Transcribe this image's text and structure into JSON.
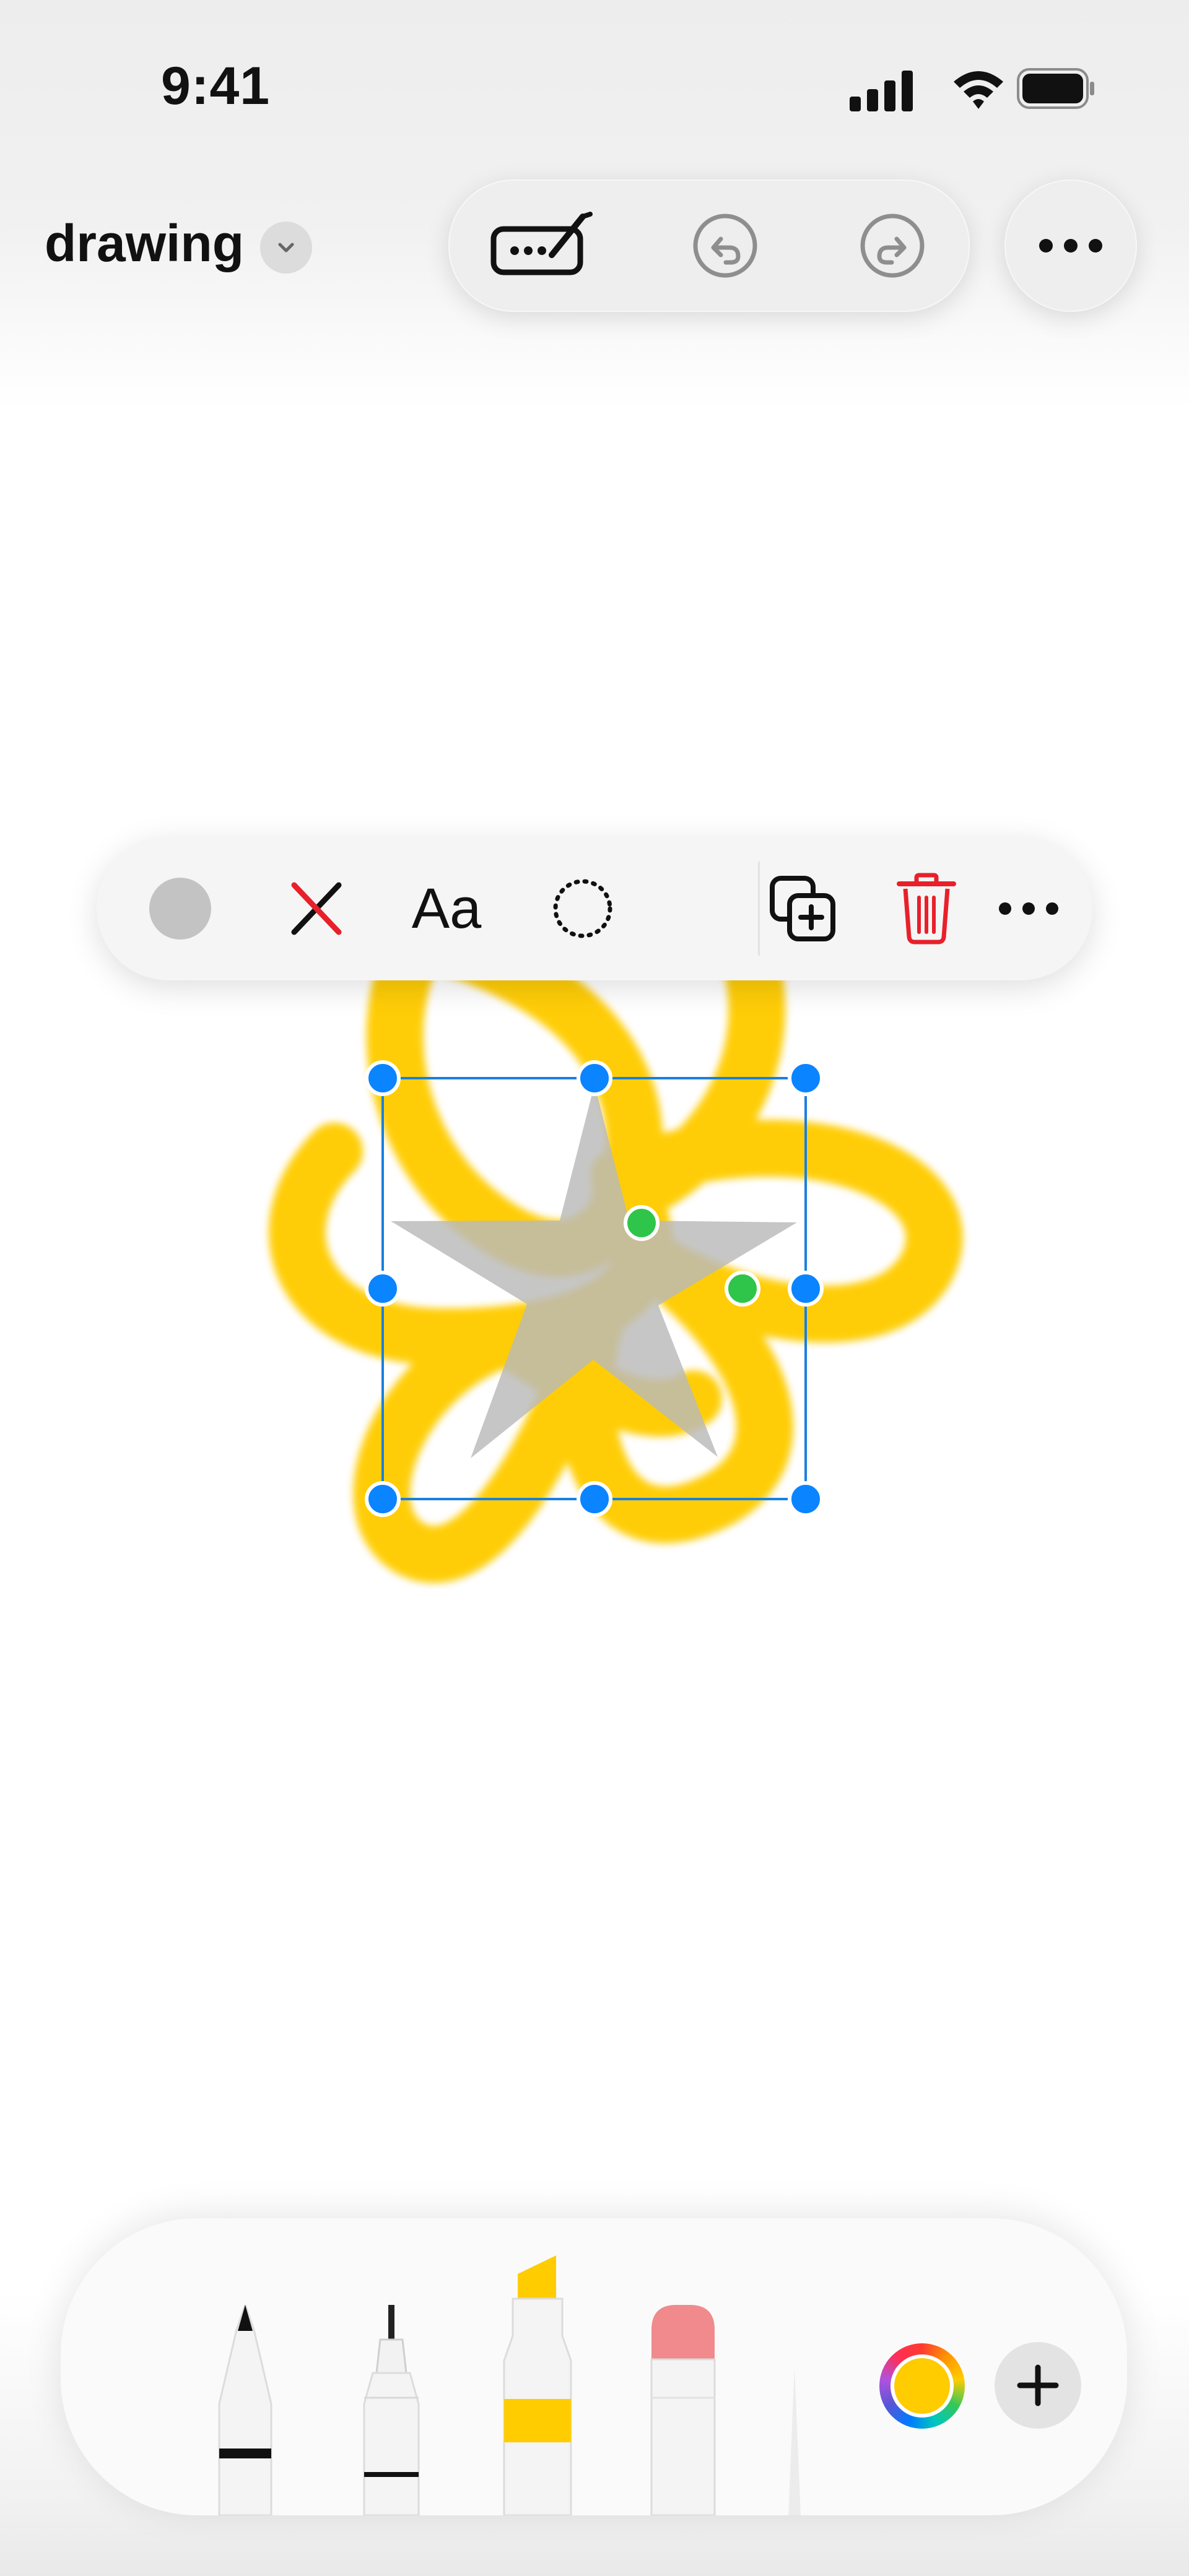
{
  "status_bar": {
    "time": "9:41",
    "icons": [
      "cellular-signal-icon",
      "wifi-icon",
      "battery-icon"
    ]
  },
  "header": {
    "title": "drawing",
    "title_menu_icon": "chevron-down-icon",
    "toolbar": [
      "markup-tools-icon",
      "undo-icon",
      "redo-icon"
    ],
    "more_icon": "ellipsis-icon"
  },
  "context_menu": {
    "items": [
      {
        "name": "fill-color",
        "icon": "gray-fill-swatch-icon"
      },
      {
        "name": "stroke",
        "icon": "no-stroke-icon"
      },
      {
        "name": "text",
        "label": "Aa"
      },
      {
        "name": "border-style",
        "icon": "dotted-circle-icon"
      },
      {
        "name": "duplicate",
        "icon": "duplicate-icon"
      },
      {
        "name": "delete",
        "icon": "trash-icon"
      },
      {
        "name": "more",
        "icon": "ellipsis-icon"
      }
    ],
    "fill_color": "#c3c3c3",
    "delete_color": "#e8202a"
  },
  "canvas": {
    "scribble_color": "#ffcc00",
    "selected_shape": "star",
    "star_fill": "#b9b9b9",
    "selection_handle_color": "#0a84ff",
    "control_handle_color": "#2ec54a"
  },
  "tool_tray": {
    "tools": [
      "pen-tool",
      "fineliner-tool",
      "highlighter-tool",
      "eraser-tool",
      "ruler-tool"
    ],
    "current_color": "#ffcc00",
    "add_icon": "plus-icon"
  }
}
